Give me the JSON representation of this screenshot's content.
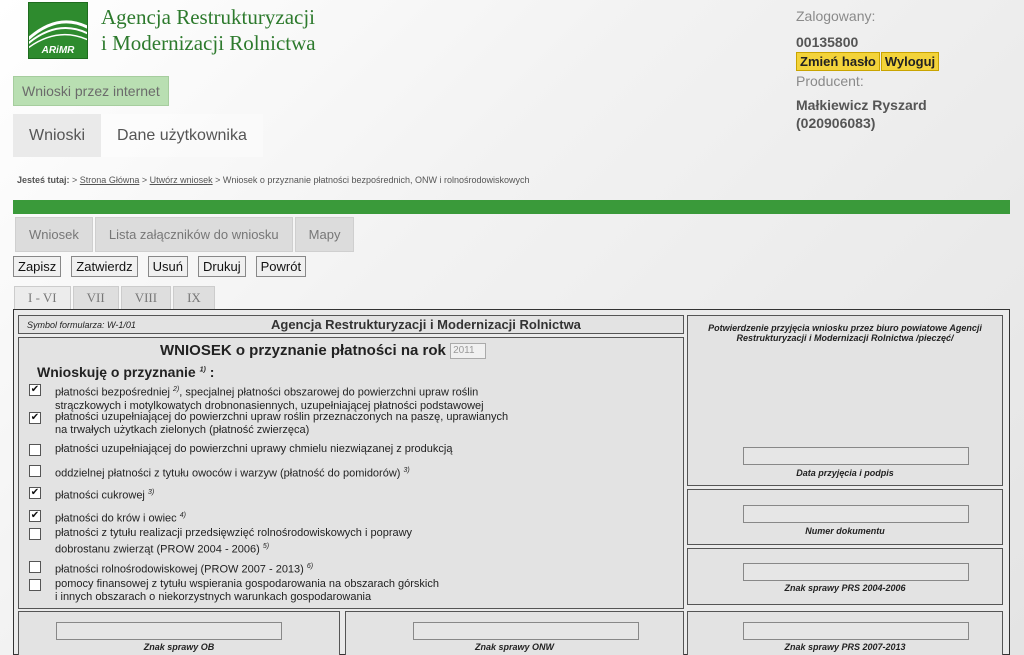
{
  "header": {
    "logo_text": "ARiMR",
    "agency_line1": "Agencja Restrukturyzacji",
    "agency_line2": "i Modernizacji Rolnictwa"
  },
  "user": {
    "logged_label": "Zalogowany:",
    "login": "00135800",
    "change_password": "Zmień hasło",
    "logout": "Wyloguj",
    "producer_label": "Producent:",
    "producer_name": "Małkiewicz Ryszard",
    "producer_id": "(020906083)"
  },
  "online_label": "Wnioski przez internet",
  "main_tabs": [
    "Wnioski",
    "Dane użytkownika"
  ],
  "breadcrumb": {
    "prefix": "Jesteś tutaj:",
    "home": "Strona Główna",
    "create": "Utwórz wniosek",
    "current": "Wniosek o przyznanie płatności bezpośrednich, ONW i rolnośrodowiskowych"
  },
  "sub_tabs": [
    "Wniosek",
    "Lista załączników do wniosku",
    "Mapy"
  ],
  "actions": [
    "Zapisz",
    "Zatwierdz",
    "Usuń",
    "Drukuj",
    "Powrót"
  ],
  "section_tabs": [
    "I - VI",
    "VII",
    "VIII",
    "IX"
  ],
  "form": {
    "symbol": "Symbol formularza: W-1/01",
    "agency_title": "Agencja Restrukturyzacji i Modernizacji Rolnictwa",
    "title": "WNIOSEK o przyznanie płatności na rok",
    "year": "2011",
    "subtitle": "Wnioskuję o przyznanie",
    "subtitle_sup": "1)",
    "subtitle_colon": ":",
    "items": [
      {
        "line1": "płatności bezpośredniej",
        "sup": "2)",
        "line1_rest": ", specjalnej płatności obszarowej do powierzchni upraw roślin",
        "line2": "strączkowych i motylkowatych drobnonasiennych, uzupełniającej płatności podstawowej",
        "checked": true
      },
      {
        "line1": "płatności uzupełniającej do powierzchni upraw roślin przeznaczonych na paszę, uprawianych",
        "sup": "",
        "line1_rest": "",
        "line2": "na trwałych użytkach zielonych (płatność zwierzęca)",
        "checked": true
      },
      {
        "line1": "płatności uzupełniającej do powierzchni uprawy chmielu niezwiązanej z produkcją",
        "sup": "",
        "line1_rest": "",
        "line2": "",
        "checked": false
      },
      {
        "line1": "oddzielnej płatności z tytułu owoców i warzyw (płatność do pomidorów)",
        "sup": "3)",
        "line1_rest": "",
        "line2": "",
        "checked": false
      },
      {
        "line1": "płatności cukrowej",
        "sup": "3)",
        "line1_rest": "",
        "line2": "",
        "checked": true
      },
      {
        "line1": "płatności do krów i owiec",
        "sup": "4)",
        "line1_rest": "",
        "line2": "",
        "checked": true
      },
      {
        "line1": "płatności z tytułu realizacji przedsięwzięć rolnośrodowiskowych i poprawy",
        "sup": "",
        "line1_rest": "",
        "line2": "dobrostanu zwierząt (PROW 2004 - 2006)",
        "sup2": "5)",
        "checked": false
      },
      {
        "line1": "płatności rolnośrodowiskowej (PROW 2007 - 2013)",
        "sup": "6)",
        "line1_rest": "",
        "line2": "",
        "checked": false
      },
      {
        "line1": "pomocy finansowej z tytułu wspierania gospodarowania na obszarach górskich",
        "sup": "",
        "line1_rest": "",
        "line2": "i innych obszarach o niekorzystnych warunkach gospodarowania",
        "checked": false
      }
    ],
    "confirmation_header": "Potwierdzenie przyjęcia wniosku przez biuro powiatowe Agencji Restrukturyzacji i Modernizacji Rolnictwa /pieczęć/",
    "date_label": "Data przyjęcia i podpis",
    "doc_number_label": "Numer dokumentu",
    "prs_2004_label": "Znak sprawy PRS 2004-2006",
    "prs_2007_label": "Znak sprawy PRS 2007-2013",
    "ob_label": "Znak sprawy OB",
    "onw_label": "Znak sprawy ONW"
  }
}
